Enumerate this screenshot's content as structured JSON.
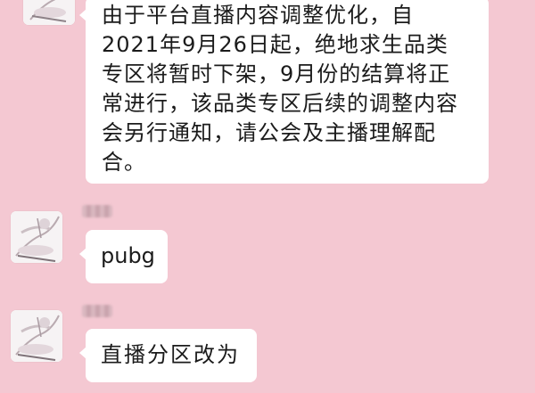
{
  "messages": [
    {
      "sender": "",
      "avatar": "blurred-avatar-image",
      "text": "由于平台直播内容调整优化，自\n2021年9月26日起，绝地求生品类\n专区将暂时下架，9月份的结算将正\n常进行，该品类专区后续的调整内容\n会另行通知，请公会及主播理解配\n合。"
    },
    {
      "sender": "",
      "avatar": "blurred-avatar-image",
      "text": "pubg"
    },
    {
      "sender": "",
      "avatar": "blurred-avatar-image",
      "text": "直播分区改为"
    }
  ],
  "colors": {
    "background": "#f4c8d2",
    "bubble": "#ffffff",
    "text": "#1b1b1b"
  }
}
